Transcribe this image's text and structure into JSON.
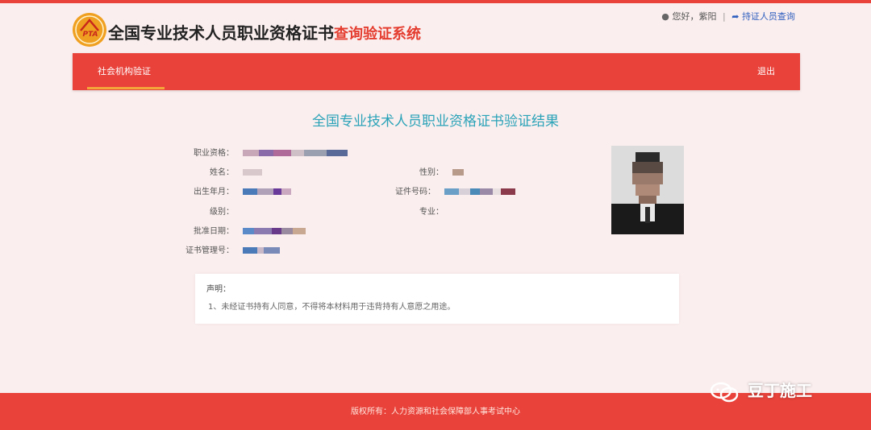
{
  "header": {
    "title_main": "全国专业技术人员职业资格证书",
    "title_sub": "查询验证系统",
    "logo_text": "PTA",
    "greeting": "您好，紫阳",
    "holder_query_link": "持证人员查询"
  },
  "nav": {
    "tab_label": "社会机构验证",
    "exit_label": "退出"
  },
  "result": {
    "title": "全国专业技术人员职业资格证书验证结果",
    "fields": {
      "qualification_label": "职业资格：",
      "name_label": "姓名：",
      "gender_label": "性别：",
      "birth_label": "出生年月：",
      "cert_no_label": "证件号码：",
      "level_label": "级别：",
      "major_label": "专业：",
      "approval_date_label": "批准日期：",
      "mgmt_no_label": "证书管理号："
    }
  },
  "declaration": {
    "heading": "声明：",
    "text": "1、未经证书持有人同意，不得将本材料用于违背持有人意愿之用途。"
  },
  "footer": {
    "copyright": "版权所有：人力资源和社会保障部人事考试中心"
  },
  "watermark": {
    "text": "豆丁施工"
  },
  "colors": {
    "brand_red": "#e8423a",
    "title_teal": "#2aa3b8",
    "page_bg": "#fbeeee"
  }
}
